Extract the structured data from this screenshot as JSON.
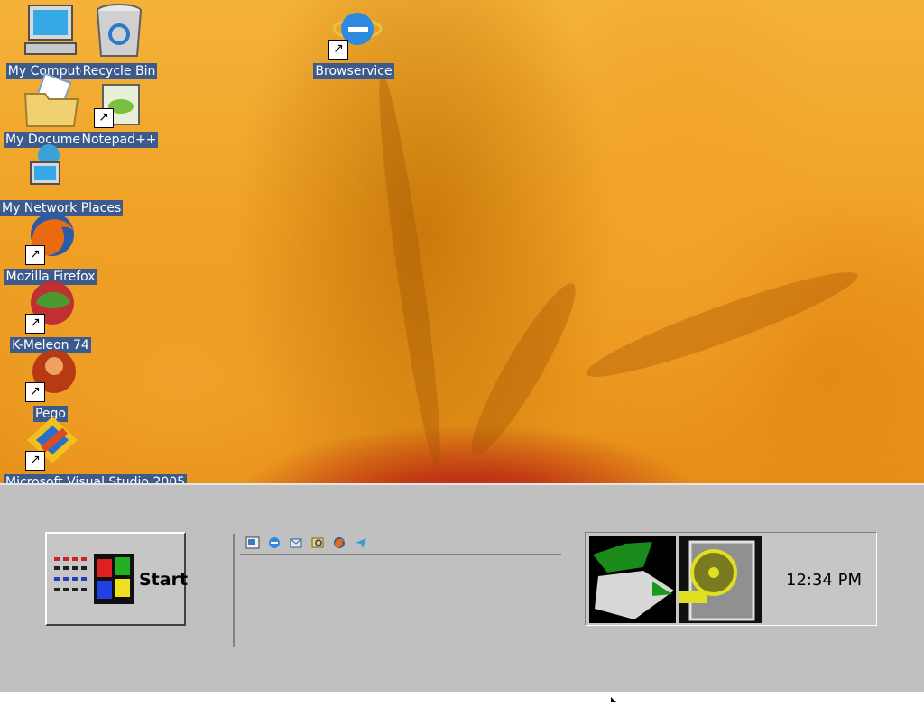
{
  "desktop": {
    "icons": [
      {
        "name": "my-computer",
        "label": "My Computer"
      },
      {
        "name": "recycle-bin",
        "label": "Recycle Bin"
      },
      {
        "name": "browservice",
        "label": "Browservice"
      },
      {
        "name": "my-documents",
        "label": "My Documents"
      },
      {
        "name": "notepad-plus-plus",
        "label": "Notepad++"
      },
      {
        "name": "my-network-places",
        "label": "My Network Places"
      },
      {
        "name": "mozilla-firefox",
        "label": "Mozilla Firefox"
      },
      {
        "name": "k-meleon",
        "label": "K-Meleon 74"
      },
      {
        "name": "pego",
        "label": "Pego"
      },
      {
        "name": "visual-studio",
        "label": "Microsoft Visual Studio 2005"
      }
    ]
  },
  "taskbar": {
    "start_label": "Start",
    "clock": "12:34 PM",
    "quicklaunch": [
      "show-desktop-icon",
      "internet-explorer-icon",
      "outlook-express-icon",
      "windows-explorer-icon",
      "firefox-icon",
      "messenger-icon"
    ]
  },
  "colors": {
    "taskbar": "#c0c0c0",
    "label_bg": "#3c5a8c",
    "wallpaper": "#f0a226"
  }
}
